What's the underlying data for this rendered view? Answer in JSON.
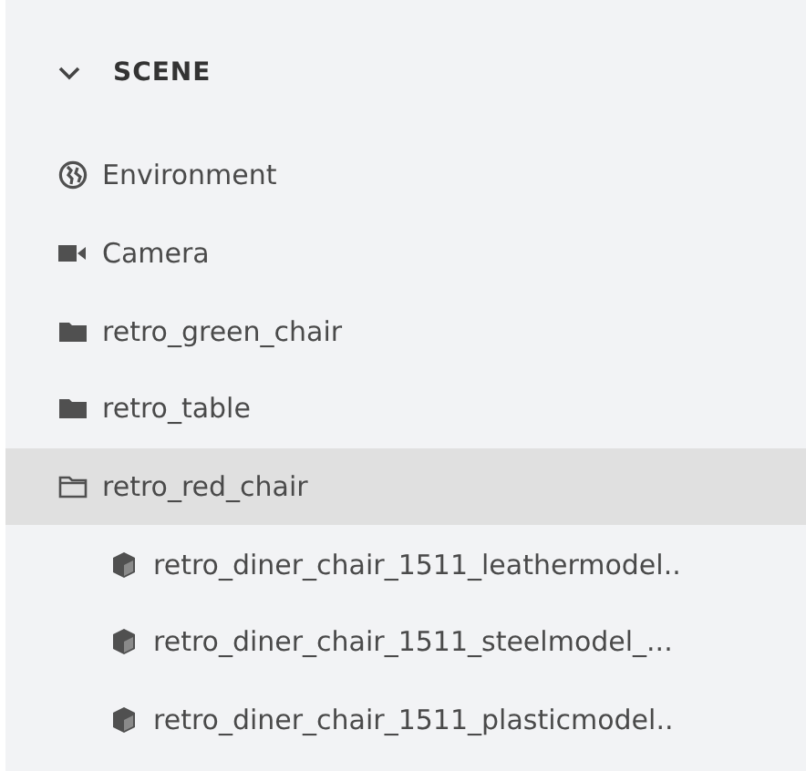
{
  "panel": {
    "title": "SCENE",
    "expanded": true,
    "items": [
      {
        "kind": "environment",
        "label": "Environment",
        "selected": false
      },
      {
        "kind": "camera",
        "label": "Camera",
        "selected": false
      },
      {
        "kind": "group",
        "label": "retro_green_chair",
        "selected": false,
        "expanded": false
      },
      {
        "kind": "group",
        "label": "retro_table",
        "selected": false,
        "expanded": false
      },
      {
        "kind": "group",
        "label": "retro_red_chair",
        "selected": true,
        "expanded": true,
        "children": [
          {
            "kind": "model",
            "label": "retro_diner_chair_1511_leathermodel..",
            "selected": false
          },
          {
            "kind": "model",
            "label": "retro_diner_chair_1511_steelmodel_...",
            "selected": false
          },
          {
            "kind": "model",
            "label": "retro_diner_chair_1511_plasticmodel..",
            "selected": false
          }
        ]
      }
    ]
  }
}
